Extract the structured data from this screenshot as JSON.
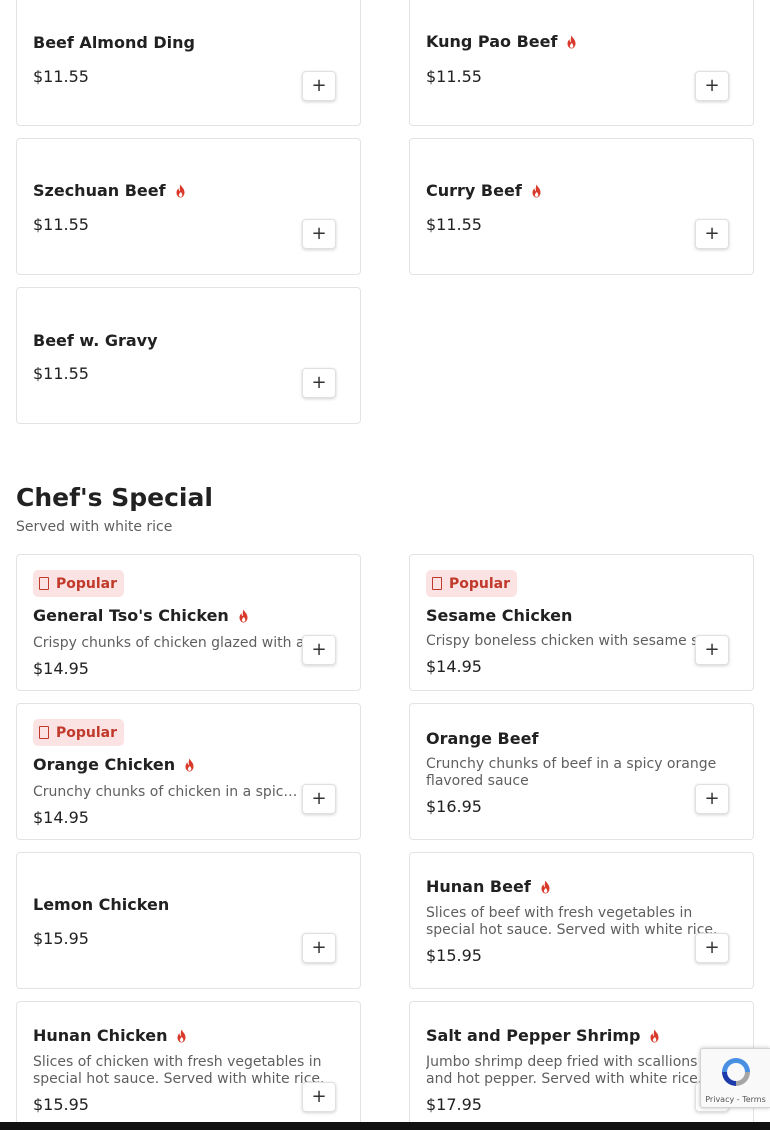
{
  "colors": {
    "spicy": "#d93a2b",
    "popular_bg": "#fbe3e3",
    "popular_text": "#c0392b"
  },
  "add_button_label": "+",
  "top_items": [
    {
      "name": "Beef Almond Ding",
      "price": "$11.55",
      "spicy": false
    },
    {
      "name": "Kung Pao Beef",
      "price": "$11.55",
      "spicy": true
    },
    {
      "name": "Szechuan Beef",
      "price": "$11.55",
      "spicy": true
    },
    {
      "name": "Curry Beef",
      "price": "$11.55",
      "spicy": true
    },
    {
      "name": "Beef w. Gravy",
      "price": "$11.55",
      "spicy": false
    }
  ],
  "section": {
    "title": "Chef's Special",
    "subtitle": "Served with white rice",
    "badge_label": "Popular",
    "items": [
      {
        "name": "General Tso's Chicken",
        "desc": "Crispy chunks of chicken glazed with a",
        "price": "$14.95",
        "spicy": true,
        "popular": true
      },
      {
        "name": "Sesame Chicken",
        "desc": "Crispy boneless chicken with sesame s",
        "price": "$14.95",
        "spicy": false,
        "popular": true
      },
      {
        "name": "Orange Chicken",
        "desc": "Crunchy chunks of chicken in a spicy orange flavored sauce",
        "price": "$14.95",
        "spicy": true,
        "popular": true
      },
      {
        "name": "Orange Beef",
        "desc": "Crunchy chunks of beef in a spicy orange flavored sauce",
        "price": "$16.95",
        "spicy": false,
        "popular": false
      },
      {
        "name": "Lemon Chicken",
        "desc": "",
        "price": "$15.95",
        "spicy": false,
        "popular": false
      },
      {
        "name": "Hunan Beef",
        "desc": "Slices of beef with fresh vegetables in special hot sauce. Served with white rice.",
        "price": "$15.95",
        "spicy": true,
        "popular": false
      },
      {
        "name": "Hunan Chicken",
        "desc": "Slices of chicken with fresh vegetables in special hot sauce. Served with white rice.",
        "price": "$15.95",
        "spicy": true,
        "popular": false
      },
      {
        "name": "Salt and Pepper Shrimp",
        "desc": "Jumbo shrimp deep fried with scallions and hot pepper. Served with white rice.",
        "price": "$17.95",
        "spicy": true,
        "popular": false
      }
    ]
  },
  "recaptcha": {
    "links": "Privacy - Terms"
  }
}
